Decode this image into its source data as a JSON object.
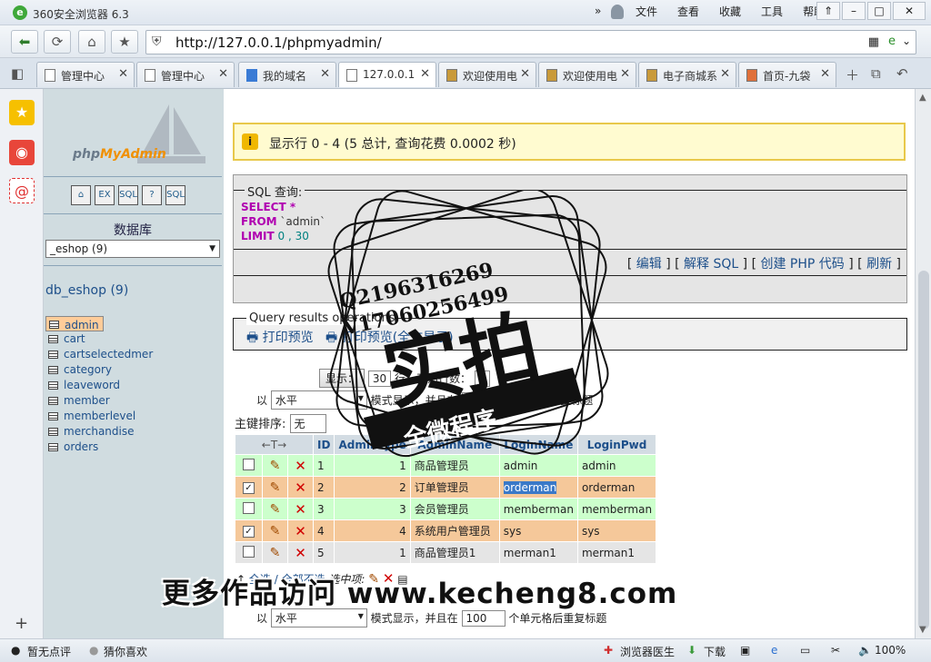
{
  "window": {
    "title": "360安全浏览器 6.3",
    "menu": [
      "文件",
      "查看",
      "收藏",
      "工具",
      "帮助"
    ]
  },
  "address": {
    "url": "http://127.0.0.1/phpmyadmin/"
  },
  "tabs": [
    {
      "label": "管理中心",
      "active": false
    },
    {
      "label": "管理中心",
      "active": false
    },
    {
      "label": "我的域名",
      "active": false
    },
    {
      "label": "127.0.0.1",
      "active": true
    },
    {
      "label": "欢迎使用电",
      "active": false
    },
    {
      "label": "欢迎使用电",
      "active": false
    },
    {
      "label": "电子商城系",
      "active": false
    },
    {
      "label": "首页-九袋",
      "active": false
    }
  ],
  "pma": {
    "logo_a": "php",
    "logo_b": "MyAdmin",
    "icon_labels": [
      "⌂",
      "EX",
      "SQL",
      "?",
      "SQL"
    ],
    "db_label": "数据库",
    "db_select": "_eshop (9)",
    "db_name": "db_eshop (9)",
    "tables": [
      "admin",
      "cart",
      "cartselectedmer",
      "category",
      "leaveword",
      "member",
      "memberlevel",
      "merchandise",
      "orders"
    ],
    "selected_table": "admin"
  },
  "notice": "显示行  0 - 4 (5 总计, 查询花费  0.0002 秒)",
  "sql": {
    "legend": "SQL 查询:",
    "line1_kw": "SELECT",
    "line1_rest": " *",
    "line2_kw": "FROM",
    "line2_rest": " `admin`",
    "line3_kw": "LIMIT",
    "line3_rest": " 0 , 30",
    "links": [
      "编辑",
      "解释 SQL",
      "创建 PHP 代码",
      "刷新"
    ]
  },
  "qro": {
    "legend": "Query results operations",
    "print_preview": "打印预览",
    "print_full": "打印预览(全文显示)"
  },
  "nav": {
    "show_btn": "显示：",
    "show_value": "30",
    "rows_label": "行，开始行数：",
    "start_value": "0",
    "mode_prefix": "以",
    "mode_value": "水平",
    "mode_suffix": "模式显示，并且在",
    "repeat_value": "100",
    "repeat_suffix": "个单元格后重复标题",
    "sort_label": "主键排序:",
    "sort_value": "无"
  },
  "grid": {
    "arrows": "←T→",
    "headers": [
      "ID",
      "AdminType",
      "AdminName",
      "LoginName",
      "LoginPwd"
    ],
    "rows": [
      {
        "id": "1",
        "type": "1",
        "name": "商品管理员",
        "login": "admin",
        "pwd": "admin",
        "checked": false
      },
      {
        "id": "2",
        "type": "2",
        "name": "订单管理员",
        "login": "orderman",
        "pwd": "orderman",
        "checked": true
      },
      {
        "id": "3",
        "type": "3",
        "name": "会员管理员",
        "login": "memberman",
        "pwd": "memberman",
        "checked": false
      },
      {
        "id": "4",
        "type": "4",
        "name": "系统用户管理员",
        "login": "sys",
        "pwd": "sys",
        "checked": true
      },
      {
        "id": "5",
        "type": "1",
        "name": "商品管理员1",
        "login": "merman1",
        "pwd": "merman1",
        "checked": false
      }
    ]
  },
  "bottom": {
    "select_all": "全选",
    "unselect_all": "全部不选",
    "with_selected": "选中项:",
    "mode_prefix": "以",
    "mode_value": "水平",
    "mode_suffix": "模式显示，并且在",
    "repeat_value": "100",
    "repeat_suffix": "个单元格后重复标题"
  },
  "watermark": {
    "qq": "Q2196316269",
    "phone": "V17060256499",
    "big": "实拍",
    "ribbon": "全微程序",
    "caption": "更多作品访问 www.kecheng8.com"
  },
  "status": {
    "left1": "暂无点评",
    "left2": "猜你喜欢",
    "doctor": "浏览器医生",
    "download": "下载",
    "zoom": "100%"
  }
}
